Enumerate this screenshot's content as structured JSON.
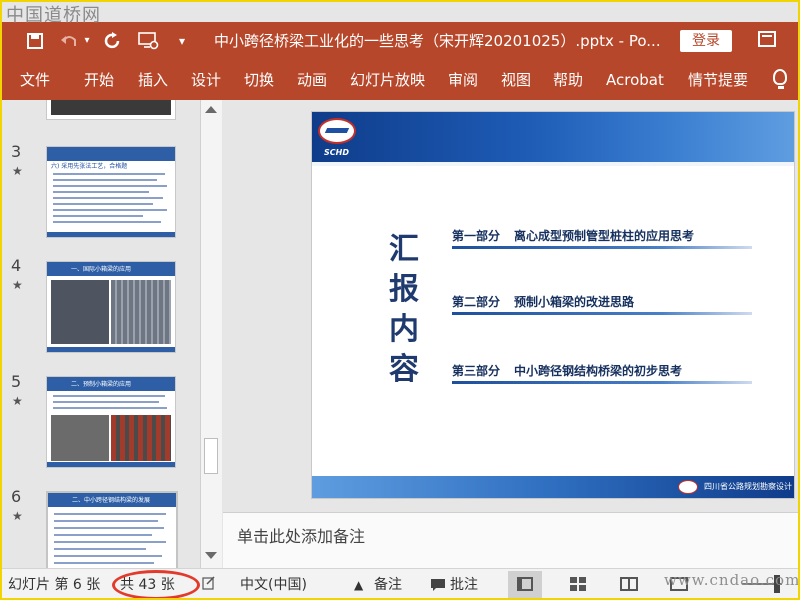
{
  "watermark": {
    "top": "中国道桥网",
    "bottom": "www.cndao.com"
  },
  "titlebar": {
    "title": "中小跨径桥梁工业化的一些思考（宋开辉20201025）.pptx  -  Po...",
    "login": "登录",
    "icons": [
      "save-icon",
      "undo-icon",
      "redo-icon",
      "present-icon",
      "customize-qa-icon",
      "restore-icon"
    ]
  },
  "ribbon": {
    "tabs": [
      "文件",
      "开始",
      "插入",
      "设计",
      "切换",
      "动画",
      "幻灯片放映",
      "审阅",
      "视图",
      "帮助",
      "Acrobat",
      "情节提要"
    ]
  },
  "thumbnails": [
    {
      "number": "3",
      "star": "★",
      "heading": "六) 采用先张法工艺，合格题"
    },
    {
      "number": "4",
      "star": "★",
      "heading": "一、国际小箱梁的应用"
    },
    {
      "number": "5",
      "star": "★",
      "heading": "二、预制小箱梁的应用"
    },
    {
      "number": "6",
      "star": "★",
      "heading": "二、中小跨径钢结构梁的发展"
    }
  ],
  "slide": {
    "logo_text": "SCHD",
    "title": "汇报内容",
    "parts": [
      {
        "label": "第一部分",
        "text": "离心成型预制管型桩柱的应用思考"
      },
      {
        "label": "第二部分",
        "text": "预制小箱梁的改进思路"
      },
      {
        "label": "第三部分",
        "text": "中小跨径钢结构桥梁的初步思考"
      }
    ],
    "footer": "四川省公路规划勘察设计"
  },
  "notes": {
    "placeholder": "单击此处添加备注"
  },
  "status": {
    "slide_label": "幻灯片 第 6 张",
    "total": "共 43 张",
    "language": "中文(中国)",
    "notes": "备注",
    "comments": "批注",
    "highlight_color": "#e23b2b"
  }
}
